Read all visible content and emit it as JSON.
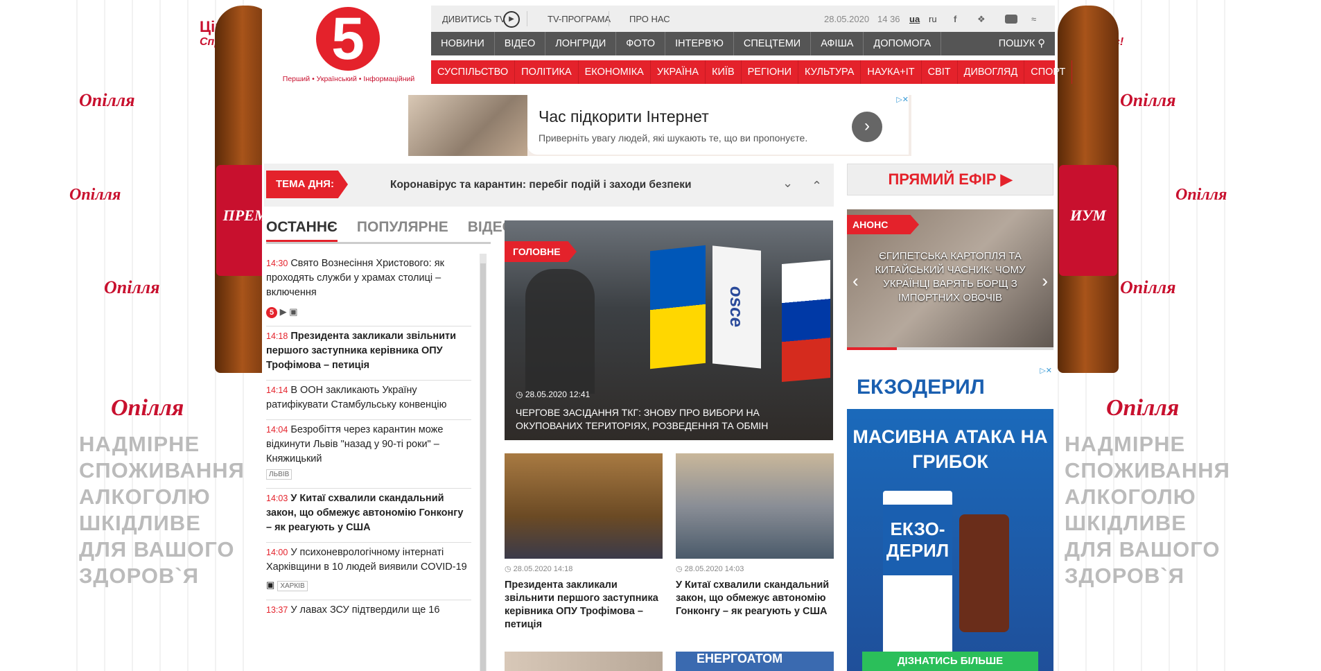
{
  "ad_side": {
    "brand": "Опілля",
    "slogan_1": "Цінуй",
    "slogan_2": "Справжнє!",
    "bottle_left": "ПРЕМ",
    "bottle_right": "ИУМ",
    "warning_1": "надмірне споживання",
    "warning_2": "алкоголю шкідливе",
    "warning_3": "для вашого здоров`я"
  },
  "logo": {
    "number": "5",
    "tagline": "Перший • Український • Інформаційний"
  },
  "topbar": {
    "watch_tv": "ДИВИТИСЬ TV",
    "tv_program": "TV-ПРОГРАМА",
    "about": "ПРО НАС",
    "date": "28.05.2020",
    "time": "14 36",
    "lang_ua": "ua",
    "lang_ru": "ru"
  },
  "nav_gray": [
    "Новини",
    "Відео",
    "Лонгріди",
    "Фото",
    "Інтерв'ю",
    "Спецтеми",
    "Афіша",
    "Допомога"
  ],
  "search_label": "ПОШУК",
  "nav_red": [
    "Суспільство",
    "Політика",
    "Економіка",
    "Україна",
    "Київ",
    "Регіони",
    "Культура",
    "Наука+IT",
    "Світ",
    "Дивогляд",
    "Спорт"
  ],
  "ad_top": {
    "title": "Час підкорити Інтернет",
    "sub": "Приверніть увагу людей, які шукають те, що ви пропонуєте."
  },
  "tema": {
    "label": "ТЕМА ДНЯ:",
    "text": "Коронавірус та карантин: перебіг подій і заходи безпеки"
  },
  "live": "ПРЯМИЙ ЕФІР",
  "tabs": [
    "ОСТАННЄ",
    "ПОПУЛЯРНЕ",
    "ВІДЕО"
  ],
  "feed": [
    {
      "time": "14:30",
      "title": "Свято Вознесіння Христового: як проходять служби у храмах столиці – включення",
      "bold": false
    },
    {
      "time": "14:18",
      "title": "Президента закликали звільнити першого заступника керівника ОПУ Трофімова – петиція",
      "bold": true
    },
    {
      "time": "14:14",
      "title": "В ООН закликають Україну ратифікувати Стамбульську конвенцію",
      "bold": false
    },
    {
      "time": "14:04",
      "title": "Безробіття через карантин може відкинути Львів \"назад у 90-ті роки\" – Княжицький",
      "bold": false,
      "tag": "ЛЬВІВ"
    },
    {
      "time": "14:03",
      "title": "У Китаї схвалили скандальний закон, що обмежує автономію Гонконгу – як реагують у США",
      "bold": true
    },
    {
      "time": "14:00",
      "title": "У психоневрологічному інтернаті Харківщини в 10 людей виявили COVID-19",
      "bold": false,
      "tag": "ХАРКІВ"
    },
    {
      "time": "13:37",
      "title": "У лавах ЗСУ підтвердили ще 16",
      "bold": false
    }
  ],
  "main_story": {
    "tag": "ГОЛОВНЕ",
    "date": "28.05.2020 12:41",
    "caption": "Чергове засідання ТКГ: знову про вибори на окупованих територіях, розведення та обмін",
    "flag_text": "osce"
  },
  "cards": [
    {
      "date": "28.05.2020 14:18",
      "title": "Президента закликали звільнити першого заступника керівника ОПУ Трофімова – петиція"
    },
    {
      "date": "28.05.2020 14:03",
      "title": "У Китаї схвалили скандальний закон, що обмежує автономію Гонконгу – як реагують у США"
    }
  ],
  "card_bottom_right_text": "ЕНЕРГОАТОМ",
  "anons": {
    "label": "АНОНС",
    "text": "Єгипетська картопля та китайський часник: чому українці варять борщ з імпортних овочів"
  },
  "ad_right": {
    "brand": "ЕКЗОДЕРИЛ",
    "headline": "МАСИВНА АТАКА НА ГРИБОК",
    "pack": "ЕКЗО-ДЕРИЛ",
    "cta": "ДІЗНАТИСЬ БІЛЬШЕ"
  },
  "colors": {
    "accent": "#e4222b",
    "nav_gray": "#555555"
  }
}
